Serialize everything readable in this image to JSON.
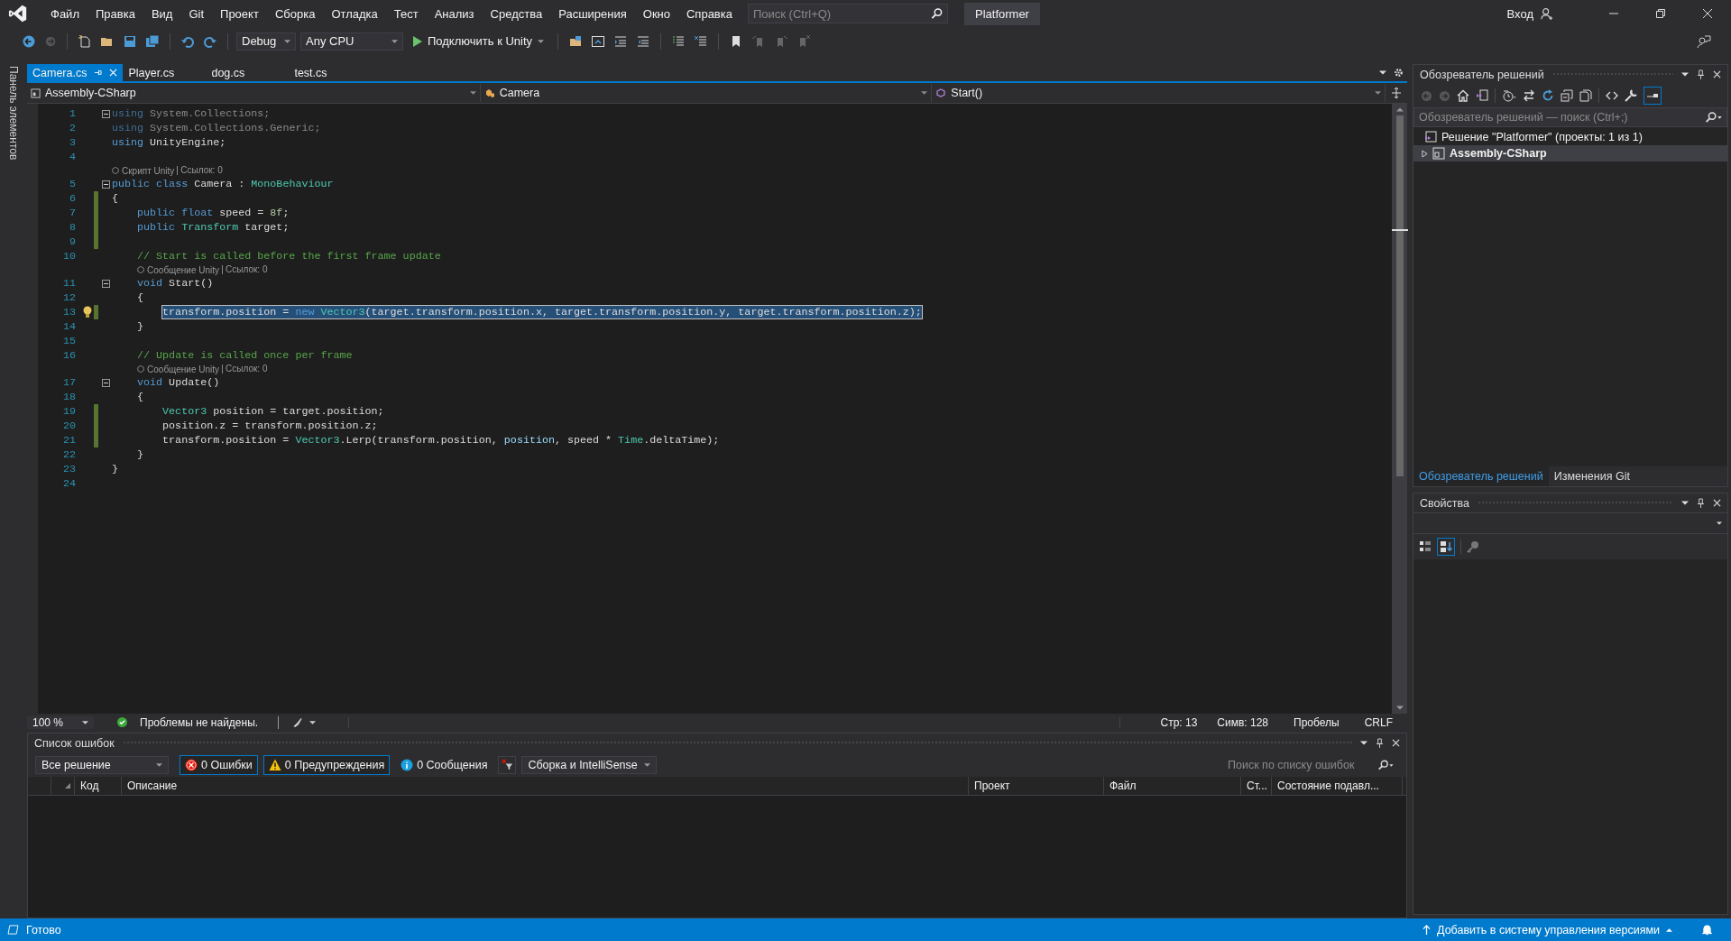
{
  "window": {
    "title": "Platformer",
    "search": {
      "placeholder": "Поиск (Ctrl+Q)"
    },
    "sign_in": "Вход"
  },
  "menu": [
    "Файл",
    "Правка",
    "Вид",
    "Git",
    "Проект",
    "Сборка",
    "Отладка",
    "Тест",
    "Анализ",
    "Средства",
    "Расширения",
    "Окно",
    "Справка"
  ],
  "toolbar": {
    "configuration": "Debug",
    "platform": "Any CPU",
    "run": "Подключить к Unity"
  },
  "toolbox_label": "Панель элементов",
  "tabs": [
    {
      "label": "Camera.cs",
      "selected": true,
      "pinned": true
    },
    {
      "label": "Player.cs",
      "selected": false,
      "pinned": false
    },
    {
      "label": "dog.cs",
      "selected": false,
      "pinned": false
    },
    {
      "label": "test.cs",
      "selected": false,
      "pinned": false
    }
  ],
  "navigation": {
    "project": "Assembly-CSharp",
    "type": "Camera",
    "member": "Start()"
  },
  "code": {
    "lines": [
      {
        "kind": "code",
        "number": "1",
        "fold": true,
        "changed": false,
        "hint": false,
        "selected": false,
        "tokens": [
          {
            "kind": "dim_keyword",
            "text": "using"
          },
          {
            "kind": "dim_text",
            "text": " System.Collections;"
          }
        ]
      },
      {
        "kind": "code",
        "number": "2",
        "fold": false,
        "changed": false,
        "hint": false,
        "selected": false,
        "tokens": [
          {
            "kind": "dim_keyword",
            "text": "using"
          },
          {
            "kind": "dim_text",
            "text": " System.Collections.Generic;"
          }
        ]
      },
      {
        "kind": "code",
        "number": "3",
        "fold": false,
        "changed": false,
        "hint": false,
        "selected": false,
        "tokens": [
          {
            "kind": "keyword",
            "text": "using"
          },
          {
            "kind": "text",
            "text": " UnityEngine;"
          }
        ]
      },
      {
        "kind": "code",
        "number": "4",
        "fold": false,
        "changed": false,
        "hint": false
      },
      {
        "kind": "codelens",
        "label": "Скрипт Unity",
        "refs": "Ссылок: 0"
      },
      {
        "kind": "code",
        "number": "5",
        "fold": true,
        "changed": false,
        "hint": false,
        "selected": false,
        "tokens": [
          {
            "kind": "keyword",
            "text": "public class"
          },
          {
            "kind": "text",
            "text": " Camera : "
          },
          {
            "kind": "type",
            "text": "MonoBehaviour"
          }
        ]
      },
      {
        "kind": "code",
        "number": "6",
        "fold": false,
        "changed": true,
        "hint": false,
        "selected": false,
        "tokens": [
          {
            "kind": "text",
            "text": "{"
          }
        ]
      },
      {
        "kind": "code",
        "number": "7",
        "fold": false,
        "changed": true,
        "hint": false,
        "selected": false,
        "tokens": [
          {
            "kind": "keyword",
            "text": "    public float"
          },
          {
            "kind": "text",
            "text": " speed = "
          },
          {
            "kind": "number",
            "text": "8f"
          },
          {
            "kind": "text",
            "text": ";"
          }
        ]
      },
      {
        "kind": "code",
        "number": "8",
        "fold": false,
        "changed": true,
        "hint": false,
        "selected": false,
        "tokens": [
          {
            "kind": "keyword",
            "text": "    public"
          },
          {
            "kind": "type",
            "text": " Transform"
          },
          {
            "kind": "text",
            "text": " target;"
          }
        ]
      },
      {
        "kind": "code",
        "number": "9",
        "fold": false,
        "changed": true,
        "hint": false
      },
      {
        "kind": "code",
        "number": "10",
        "fold": false,
        "changed": false,
        "hint": false,
        "selected": false,
        "tokens": [
          {
            "kind": "comment",
            "text": "    // Start is called before the first frame update"
          }
        ]
      },
      {
        "kind": "codelens",
        "label": "Сообщение Unity",
        "refs": "Ссылок: 0"
      },
      {
        "kind": "code",
        "number": "11",
        "fold": true,
        "changed": false,
        "hint": false,
        "selected": false,
        "tokens": [
          {
            "kind": "keyword",
            "text": "    void"
          },
          {
            "kind": "text",
            "text": " Start()"
          }
        ]
      },
      {
        "kind": "code",
        "number": "12",
        "fold": false,
        "changed": false,
        "hint": false,
        "selected": false,
        "tokens": [
          {
            "kind": "text",
            "text": "    {"
          }
        ]
      },
      {
        "kind": "code",
        "number": "13",
        "fold": false,
        "changed": true,
        "hint": true,
        "selected": true,
        "tokens": [
          {
            "kind": "text",
            "text": "        transform.position = "
          },
          {
            "kind": "keyword",
            "text": "new"
          },
          {
            "kind": "type",
            "text": " Vector3"
          },
          {
            "kind": "text",
            "text": "(target.transform.position.x, target.transform.position.y, target.transform.position.z);"
          }
        ]
      },
      {
        "kind": "code",
        "number": "14",
        "fold": false,
        "changed": false,
        "hint": false,
        "selected": false,
        "tokens": [
          {
            "kind": "text",
            "text": "    }"
          }
        ]
      },
      {
        "kind": "code",
        "number": "15",
        "fold": false,
        "changed": false,
        "hint": false
      },
      {
        "kind": "code",
        "number": "16",
        "fold": false,
        "changed": false,
        "hint": false,
        "selected": false,
        "tokens": [
          {
            "kind": "comment",
            "text": "    // Update is called once per frame"
          }
        ]
      },
      {
        "kind": "codelens",
        "label": "Сообщение Unity",
        "refs": "Ссылок: 0"
      },
      {
        "kind": "code",
        "number": "17",
        "fold": true,
        "changed": false,
        "hint": false,
        "selected": false,
        "tokens": [
          {
            "kind": "keyword",
            "text": "    void"
          },
          {
            "kind": "text",
            "text": " Update()"
          }
        ]
      },
      {
        "kind": "code",
        "number": "18",
        "fold": false,
        "changed": false,
        "hint": false,
        "selected": false,
        "tokens": [
          {
            "kind": "text",
            "text": "    {"
          }
        ]
      },
      {
        "kind": "code",
        "number": "19",
        "fold": false,
        "changed": true,
        "hint": false,
        "selected": false,
        "tokens": [
          {
            "kind": "type",
            "text": "        Vector3"
          },
          {
            "kind": "text",
            "text": " position = target.position;"
          }
        ]
      },
      {
        "kind": "code",
        "number": "20",
        "fold": false,
        "changed": true,
        "hint": false,
        "selected": false,
        "tokens": [
          {
            "kind": "text",
            "text": "        position.z = transform.position.z;"
          }
        ]
      },
      {
        "kind": "code",
        "number": "21",
        "fold": false,
        "changed": true,
        "hint": false,
        "selected": false,
        "tokens": [
          {
            "kind": "text",
            "text": "        transform.position = "
          },
          {
            "kind": "type",
            "text": "Vector3"
          },
          {
            "kind": "text",
            "text": ".Lerp(transform.position, "
          },
          {
            "kind": "variable",
            "text": "position"
          },
          {
            "kind": "text",
            "text": ", speed * "
          },
          {
            "kind": "type",
            "text": "Time"
          },
          {
            "kind": "text",
            "text": ".deltaTime);"
          }
        ]
      },
      {
        "kind": "code",
        "number": "22",
        "fold": false,
        "changed": false,
        "hint": false,
        "selected": false,
        "tokens": [
          {
            "kind": "text",
            "text": "    }"
          }
        ]
      },
      {
        "kind": "code",
        "number": "23",
        "fold": false,
        "changed": false,
        "hint": false,
        "selected": false,
        "tokens": [
          {
            "kind": "text",
            "text": "}"
          }
        ]
      },
      {
        "kind": "code",
        "number": "24",
        "fold": false,
        "changed": false,
        "hint": false
      }
    ]
  },
  "editor_status": {
    "zoom": "100 %",
    "issues": "Проблемы не найдены.",
    "line": "Стр: 13",
    "column": "Симв: 128",
    "whitespace": "Пробелы",
    "line_ending": "CRLF"
  },
  "error_list": {
    "title": "Список ошибок",
    "scope": "Все решение",
    "filters": [
      {
        "kind": "error",
        "label": "0 Ошибки",
        "selected": true
      },
      {
        "kind": "warning",
        "label": "0 Предупреждения",
        "selected": true
      },
      {
        "kind": "info",
        "label": "0 Сообщения",
        "selected": false
      }
    ],
    "source": "Сборка и IntelliSense",
    "search": {
      "placeholder": "Поиск по списку ошибок"
    },
    "columns": [
      "Код",
      "Описание",
      "Проект",
      "Файл",
      "Ст...",
      "Состояние подавл..."
    ]
  },
  "solution_explorer": {
    "title": "Обозреватель решений",
    "search": {
      "placeholder": "Обозреватель решений — поиск (Ctrl+;)"
    },
    "tree": [
      {
        "label": "Решение \"Platformer\" (проекты: 1 из 1)",
        "selected": false,
        "children": [
          {
            "label": "Assembly-CSharp",
            "expanded": false,
            "selected": true
          }
        ]
      }
    ]
  },
  "side_tabs": [
    {
      "label": "Обозреватель решений",
      "selected": true
    },
    {
      "label": "Изменения Git",
      "selected": false
    }
  ],
  "properties": {
    "title": "Свойства"
  },
  "status_bar": {
    "text": "Готово",
    "source_control": "Добавить в систему управления версиями"
  }
}
